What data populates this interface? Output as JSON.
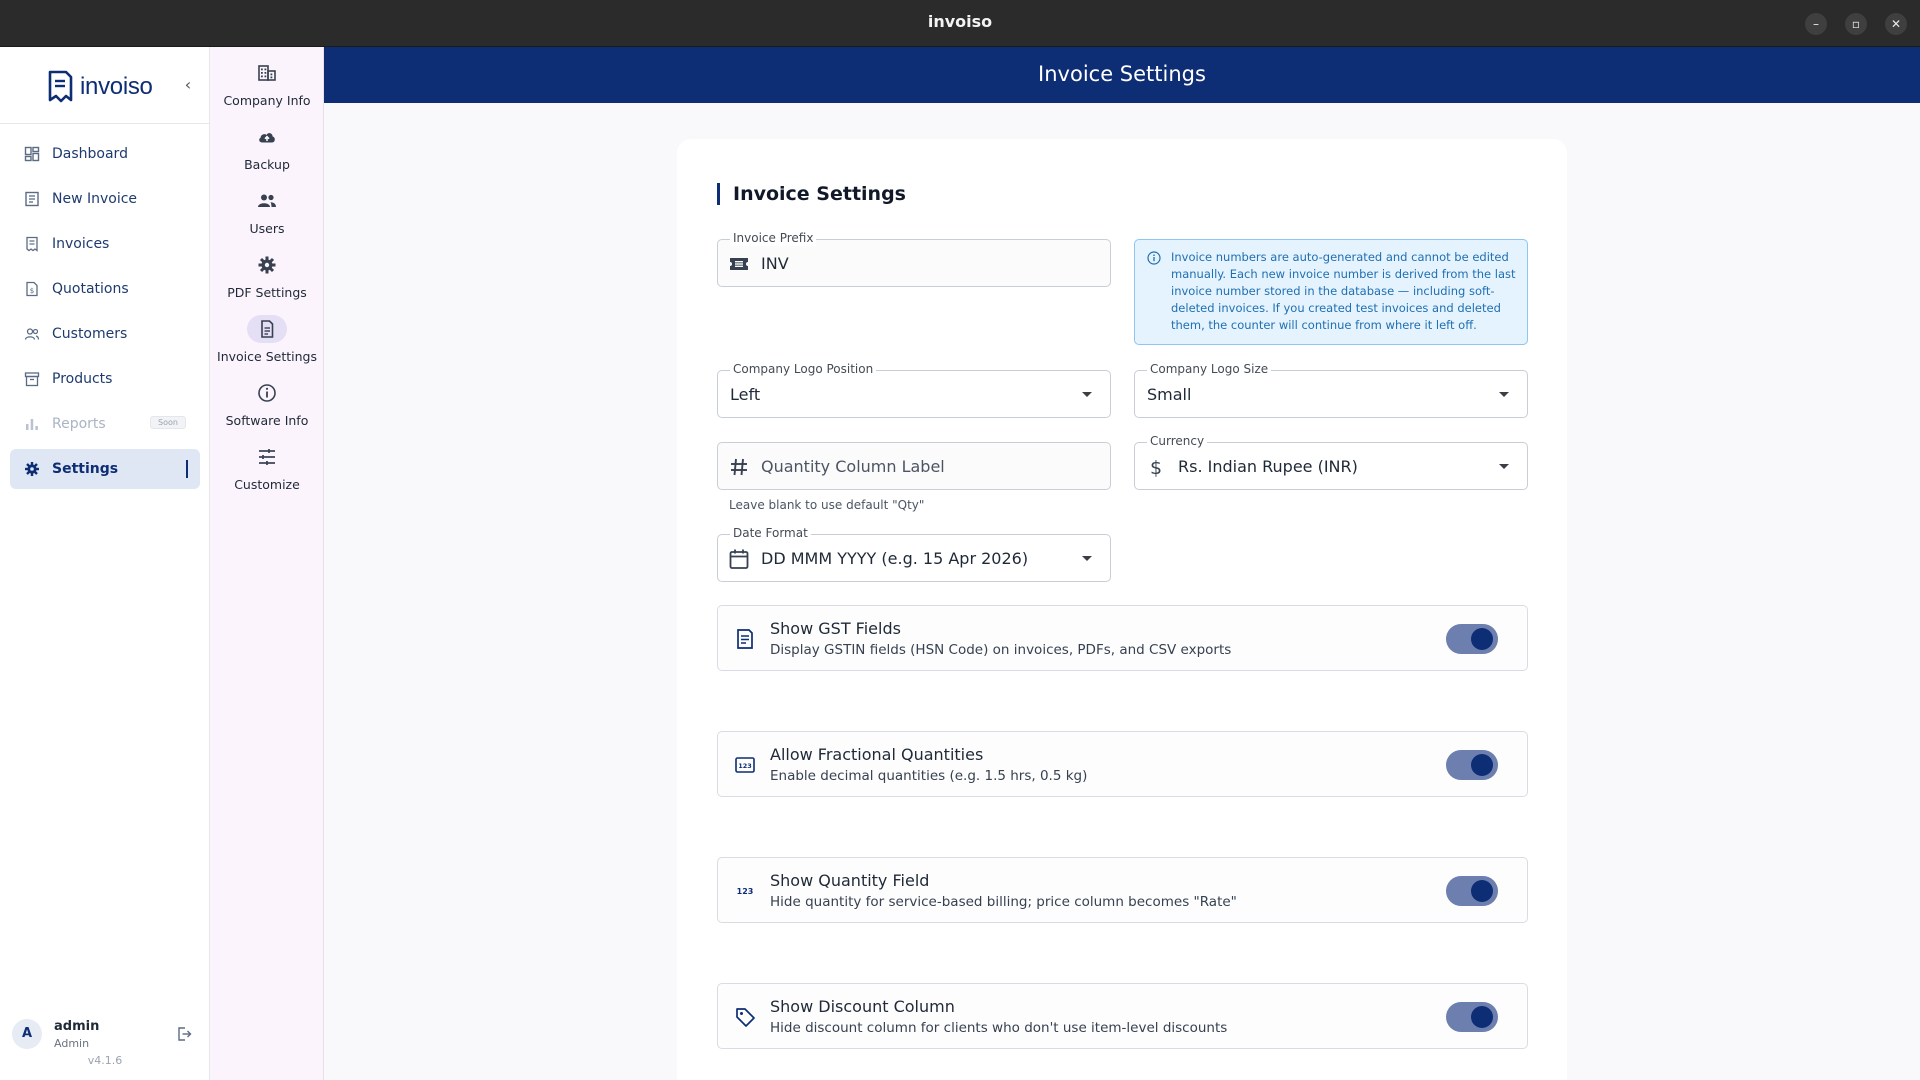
{
  "window": {
    "title": "invoiso"
  },
  "app": {
    "brand": "invoiso",
    "version": "v4.1.6"
  },
  "nav": {
    "items": [
      {
        "label": "Dashboard",
        "icon": "dashboard-icon"
      },
      {
        "label": "New Invoice",
        "icon": "new-invoice-icon"
      },
      {
        "label": "Invoices",
        "icon": "invoices-icon"
      },
      {
        "label": "Quotations",
        "icon": "quotations-icon"
      },
      {
        "label": "Customers",
        "icon": "customers-icon"
      },
      {
        "label": "Products",
        "icon": "products-icon"
      },
      {
        "label": "Reports",
        "icon": "reports-icon",
        "badge": "Soon",
        "disabled": true
      },
      {
        "label": "Settings",
        "icon": "gear-icon",
        "active": true
      }
    ]
  },
  "user": {
    "initial": "A",
    "name": "admin",
    "role": "Admin"
  },
  "settings_nav": {
    "items": [
      {
        "label": "Company Info",
        "icon": "building-icon"
      },
      {
        "label": "Backup",
        "icon": "cloud-upload-icon"
      },
      {
        "label": "Users",
        "icon": "users-icon"
      },
      {
        "label": "PDF Settings",
        "icon": "gear-icon"
      },
      {
        "label": "Invoice Settings",
        "icon": "document-icon",
        "active": true
      },
      {
        "label": "Software Info",
        "icon": "info-icon"
      },
      {
        "label": "Customize",
        "icon": "tune-icon"
      }
    ]
  },
  "header": {
    "title": "Invoice Settings"
  },
  "form": {
    "section_title": "Invoice Settings",
    "invoice_prefix": {
      "label": "Invoice Prefix",
      "value": "INV"
    },
    "info": "Invoice numbers are auto-generated and cannot be edited manually. Each new invoice number is derived from the last invoice number stored in the database — including soft-deleted invoices. If you created test invoices and deleted them, the counter will continue from where it left off.",
    "logo_position": {
      "label": "Company Logo Position",
      "value": "Left"
    },
    "logo_size": {
      "label": "Company Logo Size",
      "value": "Small"
    },
    "quantity_label": {
      "placeholder": "Quantity Column Label",
      "helper": "Leave blank to use default \"Qty\""
    },
    "currency": {
      "label": "Currency",
      "value": "Rs.  Indian Rupee (INR)"
    },
    "date_format": {
      "label": "Date Format",
      "value": "DD MMM YYYY  (e.g. 15 Apr 2026)"
    },
    "toggles": [
      {
        "title": "Show GST Fields",
        "desc": "Display GSTIN fields (HSN Code) on invoices, PDFs, and CSV exports",
        "on": true,
        "icon": "receipt-icon"
      },
      {
        "title": "Allow Fractional Quantities",
        "desc": "Enable decimal quantities (e.g. 1.5 hrs, 0.5 kg)",
        "on": true,
        "icon": "numbers-box-icon"
      },
      {
        "title": "Show Quantity Field",
        "desc": "Hide quantity for service-based billing; price column becomes \"Rate\"",
        "on": true,
        "icon": "numbers-icon"
      },
      {
        "title": "Show Discount Column",
        "desc": "Hide discount column for clients who don't use item-level discounts",
        "on": true,
        "icon": "tag-icon"
      }
    ]
  },
  "colors": {
    "primary": "#0d2d75",
    "switch_track": "#6d7fae",
    "info_bg": "#e5f3fe",
    "info_text": "#1f6fb2"
  }
}
